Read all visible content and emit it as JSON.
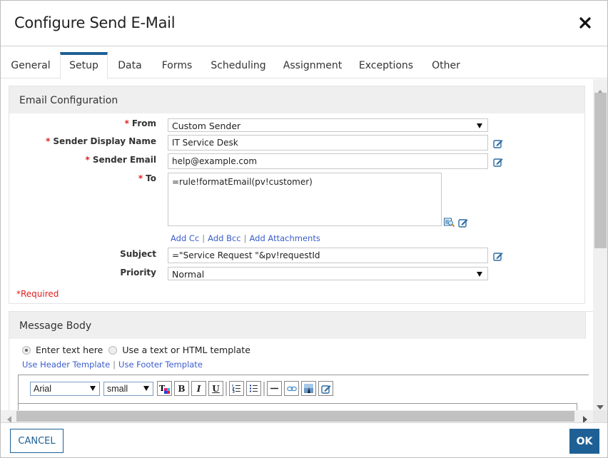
{
  "dialog": {
    "title": "Configure Send E-Mail",
    "close_icon": "close-icon"
  },
  "tabs": [
    {
      "label": "General",
      "active": false
    },
    {
      "label": "Setup",
      "active": true
    },
    {
      "label": "Data",
      "active": false
    },
    {
      "label": "Forms",
      "active": false
    },
    {
      "label": "Scheduling",
      "active": false
    },
    {
      "label": "Assignment",
      "active": false
    },
    {
      "label": "Exceptions",
      "active": false
    },
    {
      "label": "Other",
      "active": false
    }
  ],
  "email_config": {
    "heading": "Email Configuration",
    "required_marker": "*",
    "from": {
      "label": "From",
      "value": "Custom Sender"
    },
    "sender_display_name": {
      "label": "Sender Display Name",
      "value": "IT Service Desk"
    },
    "sender_email": {
      "label": "Sender Email",
      "value": "help@example.com"
    },
    "to": {
      "label": "To",
      "value": "=rule!formatEmail(pv!customer)"
    },
    "links": {
      "add_cc": "Add Cc",
      "add_bcc": "Add Bcc",
      "add_attachments": "Add Attachments",
      "separator": "|"
    },
    "subject": {
      "label": "Subject",
      "value": "=\"Service Request \"&pv!requestId"
    },
    "priority": {
      "label": "Priority",
      "value": "Normal"
    },
    "required_note": "*Required"
  },
  "message_body": {
    "heading": "Message Body",
    "radio_enter_text": {
      "label": "Enter text here",
      "checked": true
    },
    "radio_template": {
      "label": "Use a text or HTML template",
      "checked": false
    },
    "links": {
      "header_template": "Use Header Template",
      "footer_template": "Use Footer Template",
      "separator": "|"
    },
    "toolbar": {
      "font": "Arial",
      "size": "small",
      "bold": "B",
      "italic": "I",
      "underline": "U"
    }
  },
  "footer": {
    "cancel_label": "CANCEL",
    "ok_label": "OK"
  },
  "colors": {
    "accent": "#1e6095",
    "required": "#e02020",
    "link": "#3a5dcc"
  }
}
